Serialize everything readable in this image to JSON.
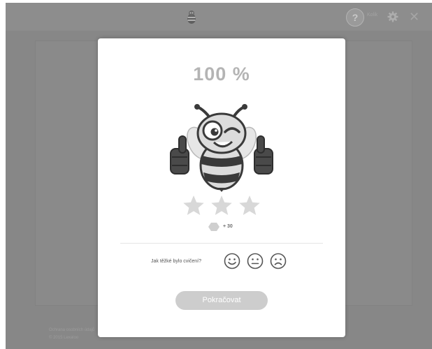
{
  "topbar": {
    "help_label": "?",
    "user_label": "Kolik",
    "close_label": "✕",
    "help_icon": "question-icon",
    "settings_icon": "gear-icon",
    "logo_icon": "bee-logo-icon"
  },
  "footer": {
    "line1": "Ochrana osobních údajů",
    "line2": "© 2015 Lexaloo"
  },
  "modal": {
    "score": "100 %",
    "stars_earned": 3,
    "stars_total": 3,
    "reward": "+ 30",
    "difficulty_question": "Jak těžké bylo cvičení?",
    "difficulty_options": [
      {
        "icon": "smile-face-icon",
        "value": "easy"
      },
      {
        "icon": "neutral-face-icon",
        "value": "ok"
      },
      {
        "icon": "sad-face-icon",
        "value": "hard"
      }
    ],
    "continue_label": "Pokračovat"
  },
  "colors": {
    "overlay_bg": "#878787",
    "score_text": "#b4b4b4",
    "star": "#d8d8d8",
    "button_bg": "#cdcdcd",
    "bee_dark": "#3a3a3a",
    "bee_light": "#dcdcdc"
  }
}
